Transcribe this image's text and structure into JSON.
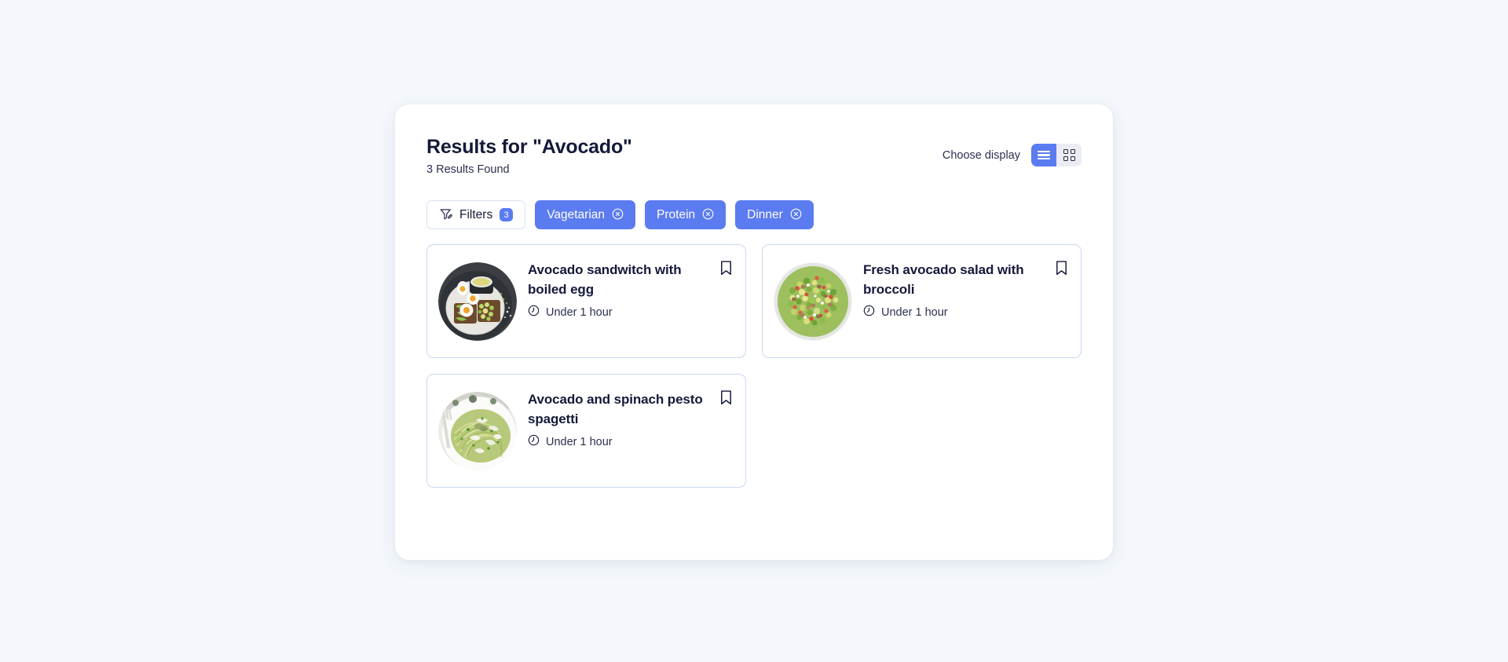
{
  "header": {
    "title": "Results for \"Avocado\"",
    "results_count": "3 Results Found",
    "display_label": "Choose display",
    "display_options": [
      {
        "name": "list-view",
        "selected": true
      },
      {
        "name": "grid-view",
        "selected": false
      }
    ]
  },
  "filters": {
    "button_label": "Filters",
    "badge_count": "3",
    "icon": "filter-edit-icon",
    "chips": [
      {
        "label": "Vagetarian",
        "remove_icon": "circle-close-icon"
      },
      {
        "label": "Protein",
        "remove_icon": "circle-close-icon"
      },
      {
        "label": "Dinner",
        "remove_icon": "circle-close-icon"
      }
    ]
  },
  "results": [
    {
      "title": "Avocado sandwitch with boiled egg",
      "time_icon": "clock-icon",
      "time": "Under 1 hour",
      "bookmark_icon": "bookmark-icon",
      "image": "avocado-toast-with-eggs"
    },
    {
      "title": "Fresh avocado salad with broccoli",
      "time_icon": "clock-icon",
      "time": "Under 1 hour",
      "bookmark_icon": "bookmark-icon",
      "image": "chopped-avocado-salad"
    },
    {
      "title": "Avocado and spinach pesto spagetti",
      "time_icon": "clock-icon",
      "time": "Under 1 hour",
      "bookmark_icon": "bookmark-icon",
      "image": "pesto-spaghetti"
    }
  ],
  "colors": {
    "page_background": "#f4f8fc",
    "panel_background": "#ffffff",
    "accent_blue": "#5b7bf0",
    "card_border": "#c9d8f2",
    "text_dark": "#15193a",
    "text_muted": "#2c3050",
    "toggle_inactive": "#ebedf2"
  }
}
